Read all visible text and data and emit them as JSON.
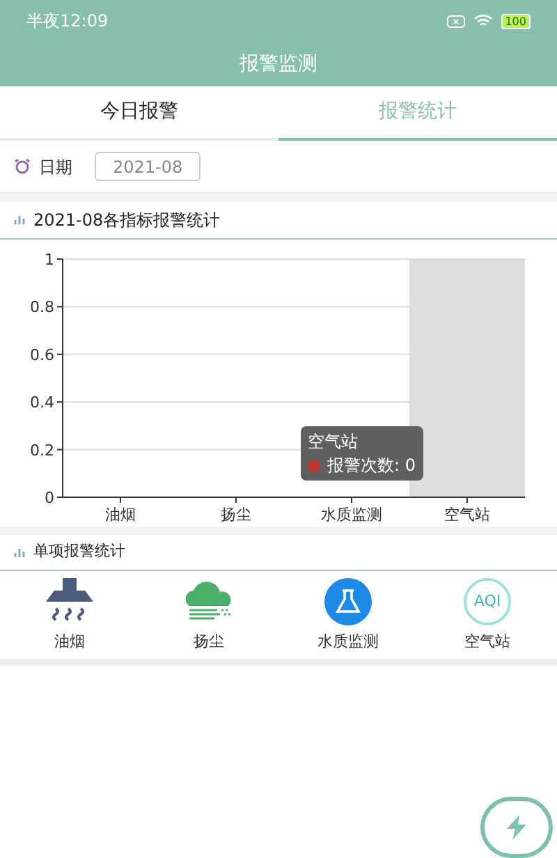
{
  "status_bar": {
    "time": "半夜12:09",
    "battery": "100"
  },
  "header": {
    "title": "报警监测"
  },
  "tabs": [
    {
      "label": "今日报警",
      "selected": false
    },
    {
      "label": "报警统计",
      "selected": true
    }
  ],
  "date_filter": {
    "label": "日期",
    "value": "2021-08"
  },
  "chart_section": {
    "title": "2021-08各指标报警统计",
    "chart_data": {
      "type": "bar",
      "categories": [
        "油烟",
        "扬尘",
        "水质监测",
        "空气站"
      ],
      "series": [
        {
          "color": "#c23531",
          "values": [
            0,
            0,
            0,
            0
          ]
        },
        {
          "color": "#dedede",
          "values": [
            null,
            null,
            null,
            1
          ]
        }
      ],
      "ylim": [
        0,
        1
      ],
      "yticks": [
        0,
        0.2,
        0.4,
        0.6,
        0.8,
        1
      ],
      "grid": true
    },
    "tooltip": {
      "title": "空气站",
      "label": "报警次数: 0"
    }
  },
  "single_section": {
    "title": "单项报警统计",
    "items": [
      {
        "kind": "hood",
        "label": "油烟"
      },
      {
        "kind": "dust",
        "label": "扬尘"
      },
      {
        "kind": "water",
        "label": "水质监测"
      },
      {
        "kind": "aqi",
        "label": "空气站",
        "icon_text": "AQI"
      }
    ]
  }
}
